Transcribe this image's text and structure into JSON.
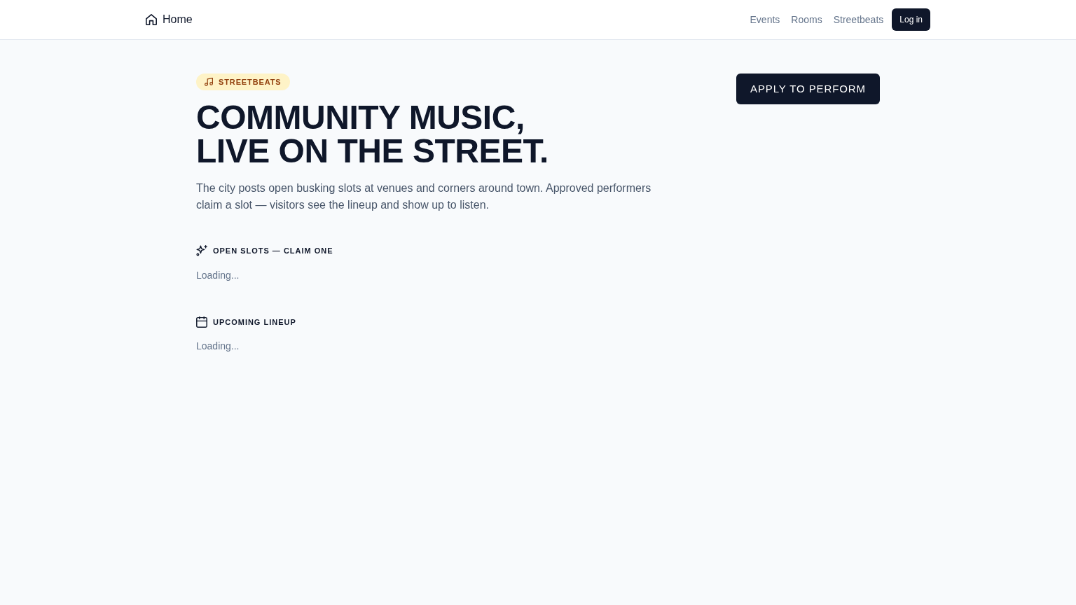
{
  "nav": {
    "brand": "Home",
    "links": [
      {
        "label": "Events"
      },
      {
        "label": "Rooms"
      },
      {
        "label": "Streetbeats"
      }
    ],
    "login": "Log in"
  },
  "hero": {
    "badge": "STREETBEATS",
    "title_lines": [
      "COMMUNITY MUSIC,",
      "LIVE ON THE STREET."
    ],
    "description": "The city posts open busking slots at venues and corners around town. Approved performers claim a slot — visitors see the lineup and show up to listen.",
    "action": "APPLY TO PERFORM"
  },
  "sections": [
    {
      "kind": "open_slots",
      "heading": "OPEN SLOTS — CLAIM ONE",
      "status": "Loading..."
    },
    {
      "kind": "lineup",
      "heading": "UPCOMING LINEUP",
      "status": "Loading..."
    }
  ]
}
